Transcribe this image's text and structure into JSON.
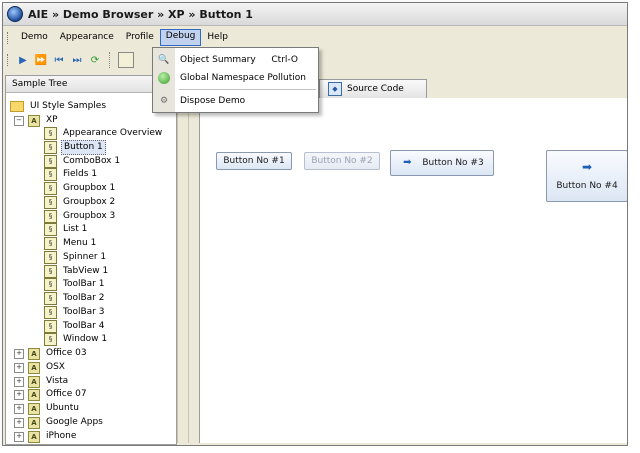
{
  "window": {
    "title": "AIE » Demo Browser » XP » Button 1"
  },
  "menubar": {
    "items": [
      {
        "label": "Demo"
      },
      {
        "label": "Appearance"
      },
      {
        "label": "Profile"
      },
      {
        "label": "Debug"
      },
      {
        "label": "Help"
      }
    ]
  },
  "debug_menu": {
    "items": [
      {
        "label": "Object Summary",
        "shortcut": "Ctrl-O",
        "icon": "magnifier-icon"
      },
      {
        "label": "Global Namespace Pollution",
        "shortcut": "",
        "icon": "globe-icon"
      },
      {
        "label": "Dispose Demo",
        "shortcut": "",
        "icon": "dispose-icon"
      }
    ]
  },
  "sidebar": {
    "header": "Sample Tree",
    "root": "UI Style Samples",
    "xp_group": "XP",
    "xp_items": [
      {
        "label": "Appearance Overview"
      },
      {
        "label": "Button 1"
      },
      {
        "label": "ComboBox 1"
      },
      {
        "label": "Fields 1"
      },
      {
        "label": "Groupbox 1"
      },
      {
        "label": "Groupbox 2"
      },
      {
        "label": "Groupbox 3"
      },
      {
        "label": "List 1"
      },
      {
        "label": "Menu 1"
      },
      {
        "label": "Spinner 1"
      },
      {
        "label": "TabView 1"
      },
      {
        "label": "ToolBar 1"
      },
      {
        "label": "ToolBar 2"
      },
      {
        "label": "ToolBar 3"
      },
      {
        "label": "ToolBar 4"
      },
      {
        "label": "Window 1"
      }
    ],
    "other_groups": [
      {
        "label": "Office 03"
      },
      {
        "label": "OSX"
      },
      {
        "label": "Vista"
      },
      {
        "label": "Office 07"
      },
      {
        "label": "Ubuntu"
      },
      {
        "label": "Google Apps"
      },
      {
        "label": "iPhone"
      }
    ]
  },
  "tabs": {
    "source": "Source Code"
  },
  "demo": {
    "buttons": [
      {
        "label": "Button No #1"
      },
      {
        "label": "Button No #2"
      },
      {
        "label": "Button No #3"
      },
      {
        "label": "Button No #4"
      }
    ]
  },
  "colors": {
    "menu_highlight": "#c1d2ee",
    "selection": "#dde6f5",
    "button_border": "#8a99b0"
  }
}
